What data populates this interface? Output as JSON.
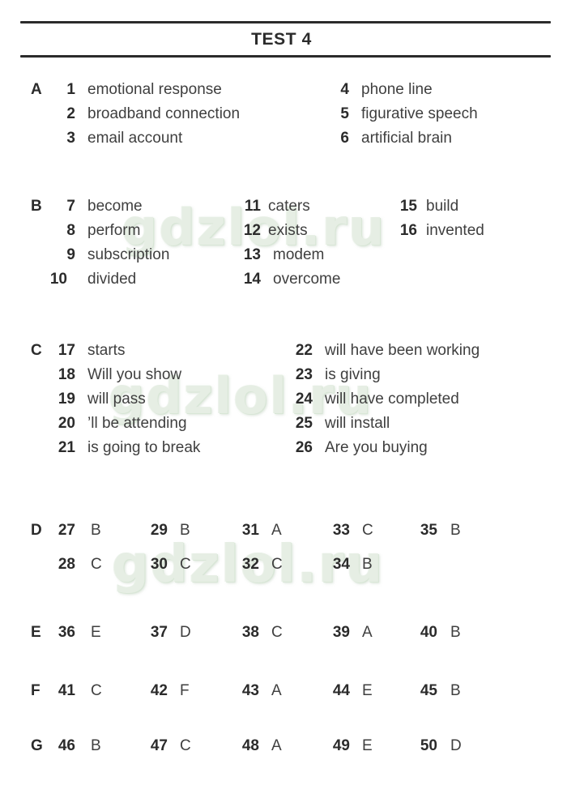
{
  "header": {
    "title": "TEST 4",
    "rule_color": "#2b2b2b"
  },
  "watermark": {
    "text": "gdzlol.ru",
    "color": "#e6eee4",
    "occurrences": 3
  },
  "colors": {
    "background": "#ffffff",
    "text": "#3a3a3a",
    "heading": "#2b2b2b",
    "watermark": "#e6eee4"
  },
  "sections": [
    {
      "letter": "A",
      "items": [
        {
          "num": "1",
          "answer": "emotional response"
        },
        {
          "num": "2",
          "answer": "broadband connection"
        },
        {
          "num": "3",
          "answer": "email account"
        },
        {
          "num": "4",
          "answer": "phone line"
        },
        {
          "num": "5",
          "answer": "figurative speech"
        },
        {
          "num": "6",
          "answer": "artificial brain"
        }
      ]
    },
    {
      "letter": "B",
      "items": [
        {
          "num": "7",
          "answer": "become"
        },
        {
          "num": "8",
          "answer": "perform"
        },
        {
          "num": "9",
          "answer": "subscription"
        },
        {
          "num": "10",
          "answer": "divided"
        },
        {
          "num": "11",
          "answer": "caters"
        },
        {
          "num": "12",
          "answer": "exists"
        },
        {
          "num": "13",
          "answer": "modem"
        },
        {
          "num": "14",
          "answer": "overcome"
        },
        {
          "num": "15",
          "answer": "build"
        },
        {
          "num": "16",
          "answer": "invented"
        }
      ]
    },
    {
      "letter": "C",
      "items": [
        {
          "num": "17",
          "answer": "starts"
        },
        {
          "num": "18",
          "answer": "Will you show"
        },
        {
          "num": "19",
          "answer": "will pass"
        },
        {
          "num": "20",
          "answer": "’ll be attending"
        },
        {
          "num": "21",
          "answer": "is going to break"
        },
        {
          "num": "22",
          "answer": "will have been working"
        },
        {
          "num": "23",
          "answer": "is giving"
        },
        {
          "num": "24",
          "answer": "will have completed"
        },
        {
          "num": "25",
          "answer": "will install"
        },
        {
          "num": "26",
          "answer": "Are you buying"
        }
      ]
    },
    {
      "letter": "D",
      "items": [
        {
          "num": "27",
          "answer": "B"
        },
        {
          "num": "28",
          "answer": "C"
        },
        {
          "num": "29",
          "answer": "B"
        },
        {
          "num": "30",
          "answer": "C"
        },
        {
          "num": "31",
          "answer": "A"
        },
        {
          "num": "32",
          "answer": "C"
        },
        {
          "num": "33",
          "answer": "C"
        },
        {
          "num": "34",
          "answer": "B"
        },
        {
          "num": "35",
          "answer": "B"
        }
      ]
    },
    {
      "letter": "E",
      "items": [
        {
          "num": "36",
          "answer": "E"
        },
        {
          "num": "37",
          "answer": "D"
        },
        {
          "num": "38",
          "answer": "C"
        },
        {
          "num": "39",
          "answer": "A"
        },
        {
          "num": "40",
          "answer": "B"
        }
      ]
    },
    {
      "letter": "F",
      "items": [
        {
          "num": "41",
          "answer": "C"
        },
        {
          "num": "42",
          "answer": "F"
        },
        {
          "num": "43",
          "answer": "A"
        },
        {
          "num": "44",
          "answer": "E"
        },
        {
          "num": "45",
          "answer": "B"
        }
      ]
    },
    {
      "letter": "G",
      "items": [
        {
          "num": "46",
          "answer": "B"
        },
        {
          "num": "47",
          "answer": "C"
        },
        {
          "num": "48",
          "answer": "A"
        },
        {
          "num": "49",
          "answer": "E"
        },
        {
          "num": "50",
          "answer": "D"
        }
      ]
    }
  ]
}
